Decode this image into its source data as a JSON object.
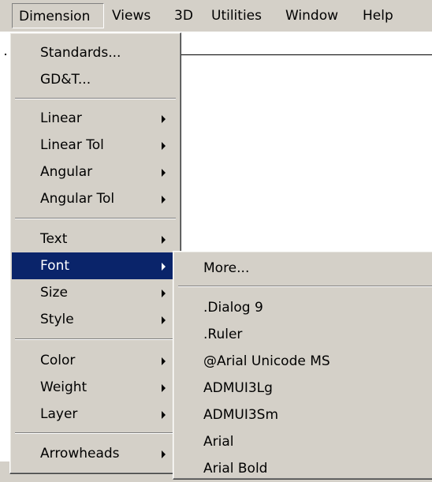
{
  "menubar": {
    "items": [
      "Dimension",
      "Views",
      "3D",
      "Utilities",
      "Window",
      "Help"
    ]
  },
  "dimension_menu": {
    "standards": "Standards...",
    "gdt": "GD&T...",
    "linear": "Linear",
    "linear_tol": "Linear Tol",
    "angular": "Angular",
    "angular_tol": "Angular Tol",
    "text": "Text",
    "font": "Font",
    "size": "Size",
    "style": "Style",
    "color": "Color",
    "weight": "Weight",
    "layer": "Layer",
    "arrowheads": "Arrowheads"
  },
  "font_submenu": {
    "more": "More...",
    "fonts": [
      ".Dialog 9",
      ".Ruler",
      "@Arial Unicode MS",
      "ADMUI3Lg",
      "ADMUI3Sm",
      "Arial",
      "Arial Bold"
    ]
  },
  "colors": {
    "menu_background": "#d4d0c8",
    "highlight": "#0a246a",
    "highlight_text": "#ffffff"
  }
}
